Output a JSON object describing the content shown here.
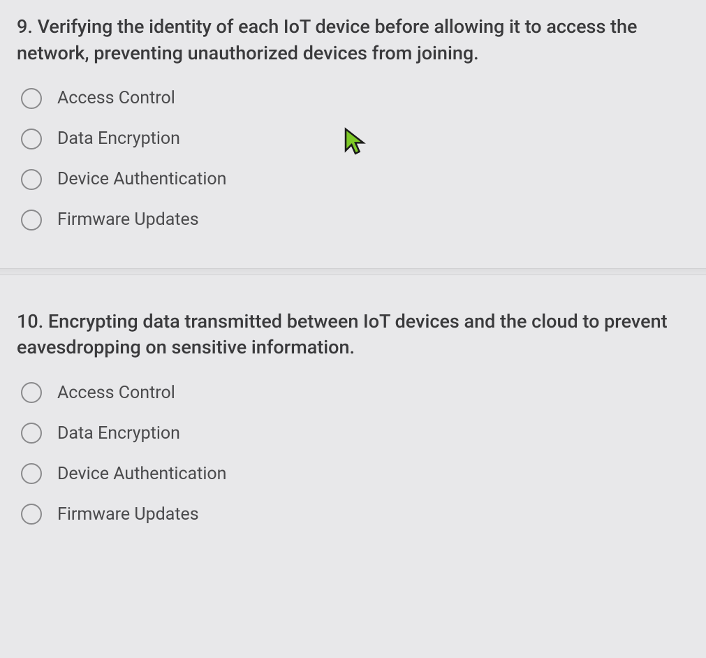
{
  "questions": [
    {
      "number": "9.",
      "text": "Verifying the identity of each IoT device before allowing it to access the network, preventing unauthorized devices from joining.",
      "options": [
        "Access Control",
        "Data Encryption",
        "Device Authentication",
        "Firmware Updates"
      ]
    },
    {
      "number": "10.",
      "text": "Encrypting data transmitted between IoT devices and the cloud to prevent eavesdropping on sensitive information.",
      "options": [
        "Access Control",
        "Data Encryption",
        "Device Authentication",
        "Firmware Updates"
      ]
    }
  ]
}
